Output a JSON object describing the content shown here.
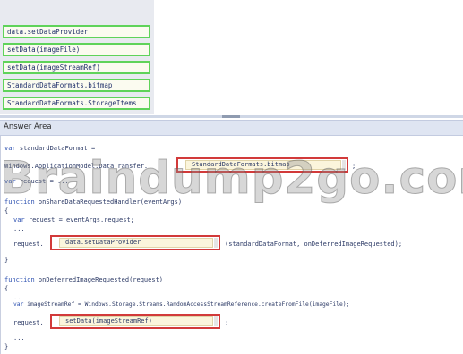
{
  "options": [
    "data.setDataProvider",
    "setData(imageFile)",
    "setData(imageStreamRef)",
    "StandardDataFormats.bitmap",
    "StandardDataFormats.StorageItems"
  ],
  "answer_area": {
    "title": "Answer Area"
  },
  "code": {
    "line1_kw": "var",
    "line1": " standardDataFormat =",
    "line2": "Windows.ApplicationModel.DataTransfer.",
    "line2_end": ";",
    "line3_kw": "var",
    "line3": " request = ...",
    "line4_kw": "function",
    "line4": " onShareDataRequestedHandler(eventArgs)",
    "line5": "{",
    "line6_kw": "var",
    "line6": " request = eventArgs.request;",
    "line7": "...",
    "line8_pre": "request.",
    "line8_post": "(standardDataFormat, onDeferredImageRequested);",
    "line9": "}",
    "line10_kw": "function",
    "line10": " onDeferredImageRequested(request)",
    "line11": "{",
    "line12": "...",
    "line13_kw": "var",
    "line13": " imageStreamRef = Windows.Storage.Streams.RandomAccessStreamReference.createFromFile(imageFile);",
    "line14_pre": "request.",
    "line14_post": ";",
    "line15": "...",
    "line16": "}"
  },
  "slots": {
    "slot1": "StandardDataFormats.bitmap",
    "slot2": "data.setDataProvider",
    "slot3": "setData(imageStreamRef)"
  },
  "watermark": "Braindump2go.com"
}
